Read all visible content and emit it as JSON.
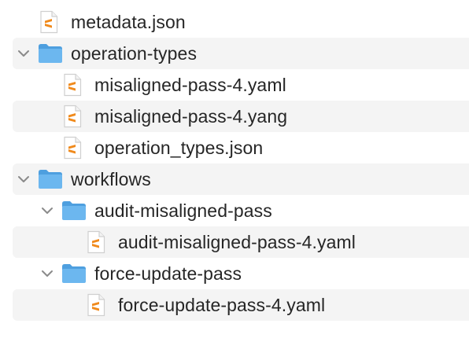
{
  "tree": {
    "rows": [
      {
        "type": "file",
        "label": "metadata.json",
        "depth": 1,
        "expanded": null
      },
      {
        "type": "folder",
        "label": "operation-types",
        "depth": 1,
        "expanded": true
      },
      {
        "type": "file",
        "label": "misaligned-pass-4.yaml",
        "depth": 2,
        "expanded": null
      },
      {
        "type": "file",
        "label": "misaligned-pass-4.yang",
        "depth": 2,
        "expanded": null
      },
      {
        "type": "file",
        "label": "operation_types.json",
        "depth": 2,
        "expanded": null
      },
      {
        "type": "folder",
        "label": "workflows",
        "depth": 1,
        "expanded": true
      },
      {
        "type": "folder",
        "label": "audit-misaligned-pass",
        "depth": 2,
        "expanded": true
      },
      {
        "type": "file",
        "label": "audit-misaligned-pass-4.yaml",
        "depth": 3,
        "expanded": null
      },
      {
        "type": "folder",
        "label": "force-update-pass",
        "depth": 2,
        "expanded": true
      },
      {
        "type": "file",
        "label": "force-update-pass-4.yaml",
        "depth": 3,
        "expanded": null
      }
    ]
  },
  "icons": {
    "file": "sublime-file-icon",
    "folder": "folder-icon",
    "chevron": "chevron-down-icon"
  },
  "colors": {
    "stripe": "#f4f4f4",
    "folder_body": "#6cb7ef",
    "folder_tab": "#4e9fdf",
    "file_accent": "#f08a1c",
    "text": "#262626"
  }
}
